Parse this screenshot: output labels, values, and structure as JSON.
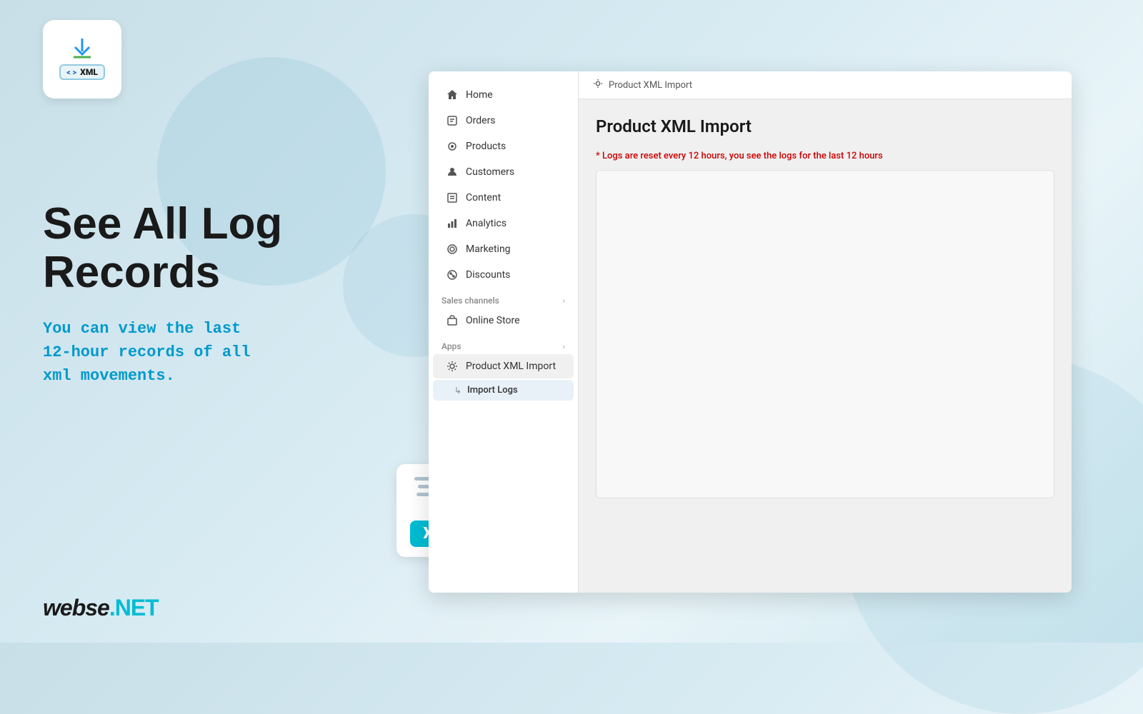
{
  "logo": {
    "xml_label": "XML",
    "code_bracket": "< >",
    "download_arrow": "⬇"
  },
  "left": {
    "heading_line1": "See All Log",
    "heading_line2": "Records",
    "subtext_line1": "You can view the last",
    "subtext_line2": "12-hour records of all",
    "subtext_line3": "xml movements."
  },
  "xml_file": {
    "badge": "XML"
  },
  "brand": {
    "name": "webse.NET"
  },
  "sidebar": {
    "nav_items": [
      {
        "id": "home",
        "label": "Home",
        "icon": "home"
      },
      {
        "id": "orders",
        "label": "Orders",
        "icon": "orders"
      },
      {
        "id": "products",
        "label": "Products",
        "icon": "products"
      },
      {
        "id": "customers",
        "label": "Customers",
        "icon": "customers"
      },
      {
        "id": "content",
        "label": "Content",
        "icon": "content"
      },
      {
        "id": "analytics",
        "label": "Analytics",
        "icon": "analytics"
      },
      {
        "id": "marketing",
        "label": "Marketing",
        "icon": "marketing"
      },
      {
        "id": "discounts",
        "label": "Discounts",
        "icon": "discounts"
      }
    ],
    "sections": [
      {
        "label": "Sales channels",
        "items": [
          {
            "id": "online-store",
            "label": "Online Store",
            "icon": "store"
          }
        ]
      },
      {
        "label": "Apps",
        "items": [
          {
            "id": "product-xml-import",
            "label": "Product XML Import",
            "icon": "app"
          },
          {
            "id": "import-logs",
            "label": "Import Logs",
            "icon": "arrow",
            "sub": true
          }
        ]
      }
    ]
  },
  "breadcrumb": {
    "icon": "⚙",
    "label": "Product XML Import"
  },
  "main": {
    "title": "Product XML Import",
    "log_notice": "* Logs are reset every 12 hours, you see the logs for the last 12 hours"
  }
}
